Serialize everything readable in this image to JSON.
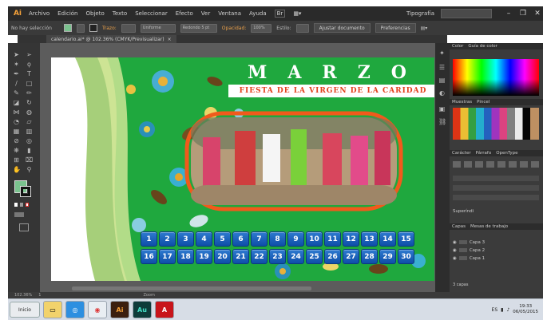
{
  "app": {
    "logo": "Ai",
    "menu": [
      "Archivo",
      "Edición",
      "Objeto",
      "Texto",
      "Seleccionar",
      "Efecto",
      "Ver",
      "Ventana",
      "Ayuda"
    ],
    "workspace": "Tipografía",
    "search_placeholder": ""
  },
  "control_bar": {
    "selection_status": "No hay selección",
    "stroke_label": "Trazo:",
    "stroke_style": "Uniforme",
    "brush": "Redondo 5 pt",
    "opacity_label": "Opacidad:",
    "opacity_value": "100%",
    "style_label": "Estilo:",
    "doc_setup_button": "Ajustar documento",
    "preferences_button": "Preferencias"
  },
  "document": {
    "tab_label": "calendario.ai* @ 102.36% (CMYK/Previsualizar)"
  },
  "artwork": {
    "month": "MARZO",
    "subtitle": "FIESTA DE LA VIRGEN DE LA CARIDAD",
    "days_row1": [
      "1",
      "2",
      "3",
      "4",
      "5",
      "6",
      "7",
      "8",
      "9",
      "10",
      "11",
      "12",
      "13",
      "14",
      "15"
    ],
    "days_row2": [
      "16",
      "17",
      "18",
      "19",
      "20",
      "21",
      "22",
      "23",
      "24",
      "25",
      "26",
      "27",
      "28",
      "29",
      "30"
    ],
    "colors": {
      "green": "#1fa83e",
      "orange": "#f05a1c",
      "day_blue": "#1466c2",
      "title_white": "#ffffff"
    }
  },
  "panels": {
    "color_tabs": [
      "Color",
      "Guía de color"
    ],
    "swatch_tabs": [
      "Muestras",
      "Pincel"
    ],
    "stroke_tabs": [
      "Carácter",
      "Párrafo",
      "OpenType"
    ],
    "superscript": "Superíndi",
    "layers_tabs": [
      "Capas",
      "Mesas de trabajo"
    ],
    "layers": [
      "Capa 3",
      "Capa 2",
      "Capa 1"
    ],
    "layers_count": "3 capas",
    "zoom": "102.36%",
    "status_zoom": "Zoom",
    "status_page": "1"
  },
  "taskbar": {
    "start_label": "Inicio",
    "tasks": [
      "explorer-icon",
      "browser-icon",
      "chrome-icon",
      "illustrator-icon",
      "audition-icon",
      "acrobat-icon"
    ],
    "language": "ES",
    "time": "19:33",
    "date": "06/05/2015"
  }
}
